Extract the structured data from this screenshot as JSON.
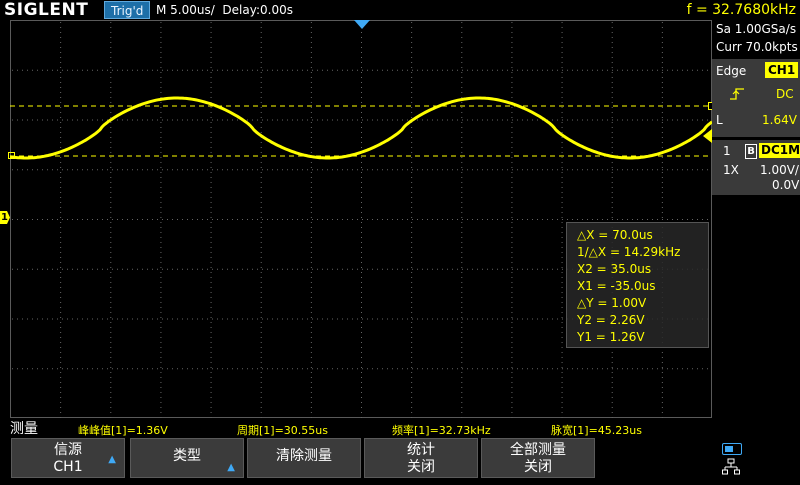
{
  "header": {
    "logo": "SIGLENT",
    "trigger_status": "Trig'd",
    "timebase": "M 5.00us/  Delay:0.00s",
    "frequency": "f = 32.7680kHz"
  },
  "acquisition": {
    "sample_rate": "Sa 1.00GSa/s",
    "memory_depth": "Curr 70.0kpts"
  },
  "trigger": {
    "type_label": "Edge",
    "source": "CH1",
    "slope_icon": "rising-edge-icon",
    "coupling": "DC",
    "level_label": "L",
    "level": "1.64V"
  },
  "channel": {
    "number": "1",
    "bw_limit": "B",
    "coupling": "DC1M",
    "probe": "1X",
    "scale": "1.00V/",
    "offset": "0.0V"
  },
  "cursors": {
    "delta_x": "△X = 70.0us",
    "inv_delta_x": "1/△X = 14.29kHz",
    "x2": "X2 = 35.0us",
    "x1": "X1 = -35.0us",
    "delta_y": "△Y = 1.00V",
    "y2": "Y2 = 2.26V",
    "y1": "Y1 = 1.26V"
  },
  "measurements": {
    "title": "测量",
    "items": [
      "峰峰值[1]=1.36V",
      "周期[1]=30.55us",
      "频率[1]=32.73kHz",
      "脉宽[1]=45.23us"
    ]
  },
  "softkeys": [
    {
      "line1": "信源",
      "line2": "CH1",
      "has_arrow": true
    },
    {
      "line1": "类型",
      "line2": "",
      "has_arrow": true
    },
    {
      "line1": "清除测量",
      "line2": "",
      "has_arrow": false
    },
    {
      "line1": "统计",
      "line2": "关闭",
      "has_arrow": false
    },
    {
      "line1": "全部测量",
      "line2": "关闭",
      "has_arrow": false
    }
  ],
  "markers": {
    "channel_marker": "1"
  },
  "colors": {
    "trace": "#ffff00",
    "accent": "#1d6fa8",
    "panel": "#3a3a3a",
    "grid": "#5a5a5a",
    "trigger_marker": "#3fa9f5"
  }
}
